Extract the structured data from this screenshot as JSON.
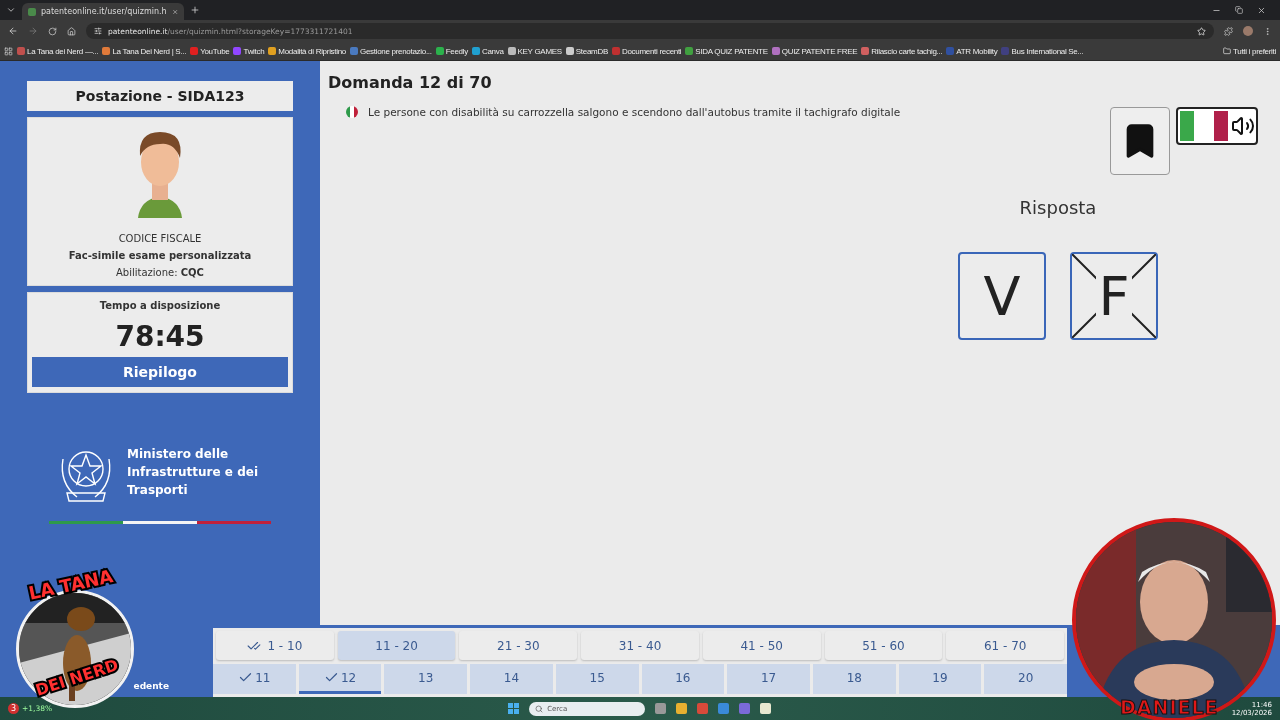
{
  "browser": {
    "tab_title": "patenteonline.it/user/quizmin.h",
    "url_host": "patenteonline.it",
    "url_path": "/user/quizmin.html?storageKey=1773311721401",
    "bookmarks": [
      {
        "label": "La Tana dei Nerd —...",
        "color": "#c0504d"
      },
      {
        "label": "La Tana Dei Nerd | S...",
        "color": "#e07a3a"
      },
      {
        "label": "YouTube",
        "color": "#e02020"
      },
      {
        "label": "Twitch",
        "color": "#9146ff"
      },
      {
        "label": "Modalità di Ripristino",
        "color": "#e0a020"
      },
      {
        "label": "Gestione prenotazio...",
        "color": "#4a7ac0"
      },
      {
        "label": "Feedly",
        "color": "#2bb24c"
      },
      {
        "label": "Canva",
        "color": "#20a0d0"
      },
      {
        "label": "KEY GAMES",
        "color": "#bbbbbb"
      },
      {
        "label": "SteamDB",
        "color": "#cccccc"
      },
      {
        "label": "Documenti recenti",
        "color": "#c03030"
      },
      {
        "label": "SIDA QUIZ PATENTE",
        "color": "#40a040"
      },
      {
        "label": "QUIZ PATENTE FREE",
        "color": "#b070c0"
      },
      {
        "label": "Rilascio carte tachig...",
        "color": "#d06060"
      },
      {
        "label": "ATR Mobility",
        "color": "#3050a0"
      },
      {
        "label": "Bus International Se...",
        "color": "#404080"
      }
    ],
    "all_bookmarks": "Tutti i preferiti"
  },
  "sidebar": {
    "station": "Postazione - SIDA123",
    "tax_code": "CODICE FISCALE",
    "exam_type": "Fac-simile esame personalizzata",
    "qualification": "Abilitazione: **CQC**",
    "time_label": "Tempo a disposizione",
    "time": "78:45",
    "summary_button": "Riepilogo",
    "ministry": [
      "Ministero delle",
      "Infrastrutture e dei",
      "Trasporti"
    ]
  },
  "question": {
    "title": "Domanda 12 di 70",
    "text": "Le persone con disabilità su carrozzella salgono e scendono dall'autobus tramite il tachigrafo digitale",
    "answer_label": "Risposta",
    "answers": [
      {
        "label": "V",
        "crossed": false
      },
      {
        "label": "F",
        "crossed": true
      }
    ]
  },
  "nav": {
    "prev_button": "edente",
    "ranges": [
      {
        "label": "1 - 10",
        "checked": true,
        "selected": false
      },
      {
        "label": "11 - 20",
        "checked": false,
        "selected": true
      },
      {
        "label": "21 - 30",
        "checked": false,
        "selected": false
      },
      {
        "label": "31 - 40",
        "checked": false,
        "selected": false
      },
      {
        "label": "41 - 50",
        "checked": false,
        "selected": false
      },
      {
        "label": "51 - 60",
        "checked": false,
        "selected": false
      },
      {
        "label": "61 - 70",
        "checked": false,
        "selected": false
      }
    ],
    "numbers": [
      {
        "label": "11",
        "answered": true,
        "selected": false
      },
      {
        "label": "12",
        "answered": true,
        "selected": true
      },
      {
        "label": "13",
        "answered": false,
        "selected": false
      },
      {
        "label": "14",
        "answered": false,
        "selected": false
      },
      {
        "label": "15",
        "answered": false,
        "selected": false
      },
      {
        "label": "16",
        "answered": false,
        "selected": false
      },
      {
        "label": "17",
        "answered": false,
        "selected": false
      },
      {
        "label": "18",
        "answered": false,
        "selected": false
      },
      {
        "label": "19",
        "answered": false,
        "selected": false
      },
      {
        "label": "20",
        "answered": false,
        "selected": false
      }
    ]
  },
  "overlay": {
    "logo_top": "LA TANA",
    "logo_bottom": "DEI NERD",
    "webcam_caption": "DANIELE"
  },
  "taskbar": {
    "widget_badge": "3",
    "widget_change": "+1,38%",
    "search_placeholder": "Cerca",
    "time": "11:46",
    "date": "12/03/2026"
  }
}
